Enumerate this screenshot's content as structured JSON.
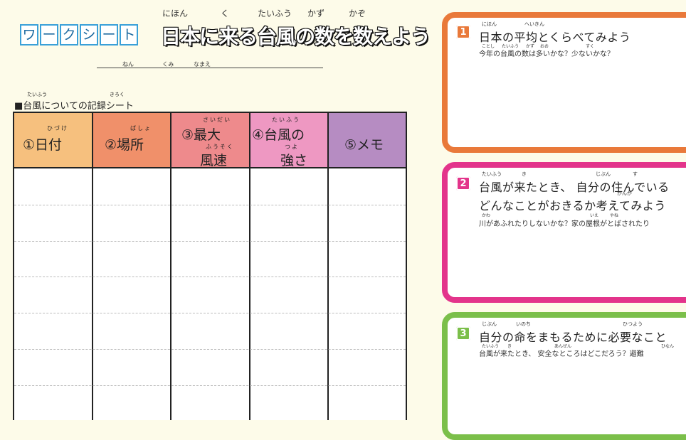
{
  "title": {
    "label_chars": [
      "ワ",
      "ー",
      "ク",
      "シ",
      "ー",
      "ト"
    ],
    "main": "日本に来る台風の数を数えよう",
    "ruby": [
      "にほん",
      "く",
      "たいふう",
      "かず",
      "かぞ"
    ]
  },
  "name_fields": [
    "ねん",
    "くみ",
    "なまえ"
  ],
  "record": {
    "caption": "■台風についての記録シート",
    "caption_ruby": [
      "たいふう",
      "きろく"
    ]
  },
  "table": {
    "headers": [
      {
        "text": "①日付",
        "ruby": "ひづけ",
        "color": "#f6c07e"
      },
      {
        "text": "②場所",
        "ruby": "ばしょ",
        "color": "#f0906a"
      },
      {
        "text": "③最大",
        "text2": "風速",
        "ruby": "さいだい",
        "ruby2": "ふうそく",
        "color": "#ee8a8c"
      },
      {
        "text": "④台風の",
        "text2": "強さ",
        "ruby": "たいふう",
        "ruby2": "つよ",
        "color": "#ee98c2"
      },
      {
        "text": "⑤メモ",
        "color": "#b68cc2"
      }
    ]
  },
  "questions": [
    {
      "num": "1",
      "color": "#e9793a",
      "title": "日本の平均とくらべてみよう",
      "ruby": [
        "にほん",
        "へいきん"
      ],
      "sub": "今年の台風の数は多いかな？少ないかな？",
      "sub_ruby": [
        "ことし",
        "たいふう",
        "かず",
        "おお",
        "すく"
      ]
    },
    {
      "num": "2",
      "color": "#e3348b",
      "title": "台風が来たとき、 自分の住んでいる",
      "title2": "どんなことがおきるか考えてみよう",
      "ruby": [
        "たいふう",
        "き",
        "じぶん",
        "す"
      ],
      "ruby2": [
        "かんが"
      ],
      "sub": "川があふれたりしないかな？家の屋根がとばされたり",
      "sub_ruby": [
        "かわ",
        "いえ",
        "やね"
      ]
    },
    {
      "num": "3",
      "color": "#7bbf4a",
      "title": "自分の命をまもるために必要なこと",
      "ruby": [
        "じぶん",
        "いのち",
        "ひつよう"
      ],
      "sub": "台風が来たとき、 安全なところはどこだろう？避難",
      "sub_ruby": [
        "たいふう",
        "き",
        "あんぜん",
        "ひなん"
      ]
    }
  ]
}
